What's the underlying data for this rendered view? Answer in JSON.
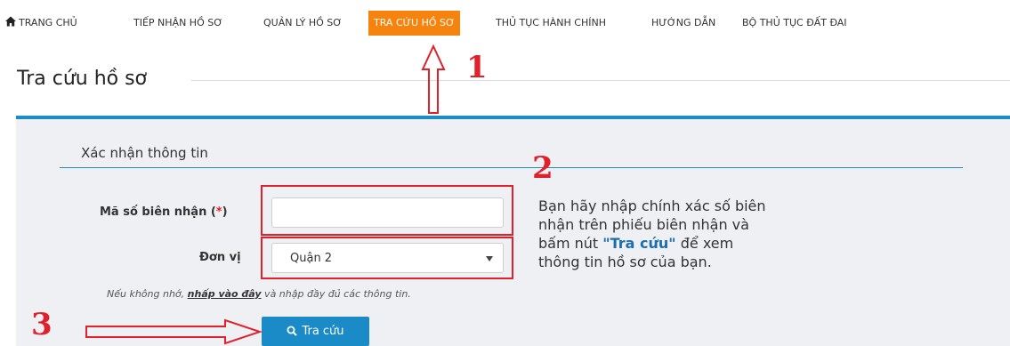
{
  "nav": {
    "items": [
      {
        "label": "TRANG CHỦ"
      },
      {
        "label": "TIẾP NHẬN HỒ SƠ"
      },
      {
        "label": "QUẢN LÝ HỒ SƠ"
      },
      {
        "label": "TRA CỨU HỒ SƠ",
        "active": true
      },
      {
        "label": "THỦ TỤC HÀNH CHÍNH"
      },
      {
        "label": "HƯỚNG DẪN"
      },
      {
        "label": "BỘ THỦ TỤC ĐẤT ĐAI"
      }
    ],
    "active_color": "#f7830f"
  },
  "page": {
    "title": "Tra cứu hồ sơ"
  },
  "form": {
    "section_title": "Xác nhận thông tin",
    "receipt_label": "Mã số biên nhận (",
    "required_mark": "*",
    "receipt_label_close": ")",
    "receipt_value": "",
    "unit_label": "Đơn vị",
    "unit_value": "Quận 2",
    "hint_prefix": "Nếu không nhớ, ",
    "hint_link": "nhấp vào đây",
    "hint_suffix": " và nhập đầy đủ các thông tin.",
    "submit_label": "Tra cứu"
  },
  "help": {
    "part1": "Bạn hãy nhập chính xác số biên nhận trên phiếu biên nhận và bấm nút ",
    "emphasis": "\"Tra cứu\"",
    "part2": " để xem thông tin hồ sơ của bạn."
  },
  "annotations": {
    "step1": "1",
    "step2": "2",
    "step3": "3",
    "color": "#e0202a"
  },
  "colors": {
    "accent_blue": "#1a8dc9",
    "panel_bg": "#eef0f3"
  }
}
